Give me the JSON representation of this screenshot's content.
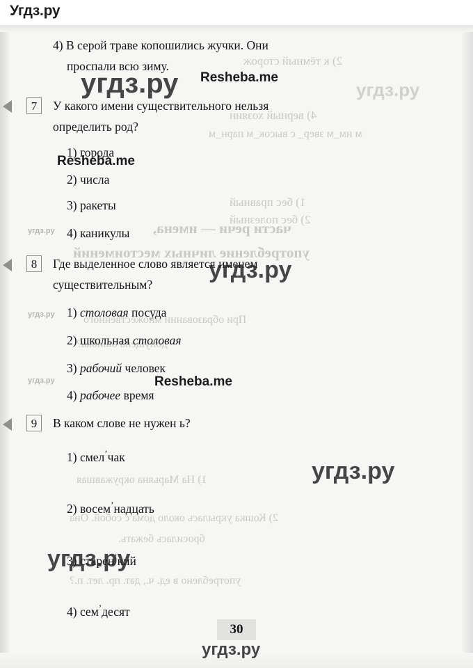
{
  "site": {
    "logo": "Угдз.ру"
  },
  "page": {
    "number": "30"
  },
  "questions": [
    {
      "number": "4)",
      "is_numbered_box": false,
      "text_line1": "4) В серой траве копошились жучки. Они",
      "text_line2": "проспали всю зиму."
    },
    {
      "number": "7",
      "text_line1": "У какого имени существительного нельзя",
      "text_line2": "определить род?",
      "options": [
        {
          "label": "1) города"
        },
        {
          "label": "2) числа"
        },
        {
          "label": "3) ракеты"
        },
        {
          "label": "4) каникулы"
        }
      ]
    },
    {
      "number": "8",
      "text_line1": "Где выделенное слово является именем",
      "text_line2": "существительным?",
      "options": [
        {
          "pre": "1) ",
          "italic": "столовая",
          "post": " посуда"
        },
        {
          "pre": "2) школьная ",
          "italic": "столовая",
          "post": ""
        },
        {
          "pre": "3) ",
          "italic": "рабочий",
          "post": " человек"
        },
        {
          "pre": "4) ",
          "italic": "рабочее",
          "post": " время"
        }
      ]
    },
    {
      "number": "9",
      "text_line1": "В каком слове не нужен ь?",
      "options": [
        {
          "pre": "1) смел",
          "mark": "ʼ",
          "post": "чак"
        },
        {
          "pre": "2) восем",
          "mark": "ʼ",
          "post": "надцать"
        },
        {
          "pre": "3) старен",
          "mark": "ʼ",
          "post": "кий"
        },
        {
          "pre": "4) сем",
          "mark": "ʼ",
          "post": "десят"
        }
      ]
    }
  ],
  "watermarks": {
    "big": "угдз.ру",
    "brand": "Resheba.me",
    "small": "угдз.ру"
  },
  "bleed_through": [
    {
      "text": "2) к тёмный сторож"
    },
    {
      "text": "4) верный хозяин"
    },
    {
      "text": "м им_м звер_ с высок_м парн_м"
    },
    {
      "text": "1) бес правный"
    },
    {
      "text": "2) бес полезный"
    },
    {
      "text": "части речи — имена,"
    },
    {
      "text": "употребление личных местоимений"
    },
    {
      "text": "При образовании множественного"
    },
    {
      "text": "допущена ошибка?"
    },
    {
      "text": "1) На Марьяна окружавшая"
    },
    {
      "text": "2) Кошка укрылась около дома с собой. Она"
    },
    {
      "text": "бросилась бежать."
    },
    {
      "text": "употреблено в ед. ч., дат. пр. лет. п.?"
    }
  ]
}
